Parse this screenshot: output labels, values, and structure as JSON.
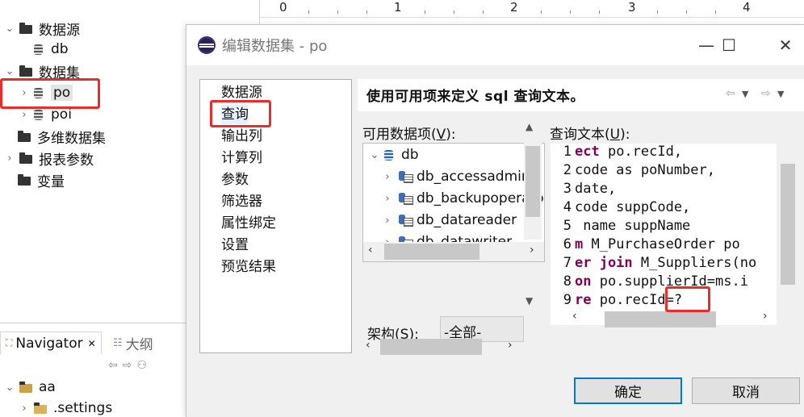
{
  "left_tree": {
    "items": [
      {
        "label": "数据源",
        "twisty": "⌄",
        "icon": "folder-icon"
      },
      {
        "label": "db",
        "twisty": "",
        "icon": "database-icon"
      },
      {
        "label": "数据集",
        "twisty": "⌄",
        "icon": "folder-icon"
      },
      {
        "label": "po",
        "twisty": "›",
        "icon": "dataset-icon"
      },
      {
        "label": "poi",
        "twisty": "›",
        "icon": "dataset-icon"
      },
      {
        "label": "多维数据集",
        "twisty": "",
        "icon": "folder-icon"
      },
      {
        "label": "报表参数",
        "twisty": "›",
        "icon": "folder-icon"
      },
      {
        "label": "变量",
        "twisty": "",
        "icon": "folder-icon"
      }
    ]
  },
  "ruler": {
    "numbers": [
      "0",
      "1",
      "2",
      "3",
      "4"
    ]
  },
  "navigator": {
    "tab_navigator": "Navigator",
    "tab_close": "✕",
    "tab_outline": "大纲",
    "tree": [
      {
        "label": "aa",
        "twisty": "⌄",
        "icon": "project-folder-icon"
      },
      {
        "label": ".settings",
        "twisty": "›",
        "icon": "folder-icon"
      }
    ]
  },
  "dialog": {
    "title": "编辑数据集 - po",
    "minimize": "—",
    "maximize": "☐",
    "close": "✕",
    "pages": [
      "数据源",
      "查询",
      "输出列",
      "计算列",
      "参数",
      "筛选器",
      "属性绑定",
      "设置",
      "预览结果"
    ],
    "header_text": "使用可用项来定义 sql 查询文本。",
    "available_label": "可用数据项(",
    "available_mnemonic": "V",
    "available_label_end": "):",
    "query_label": "查询文本(",
    "query_mnemonic": "U",
    "query_label_end": "):",
    "data_tree": {
      "root": "db",
      "children": [
        "db_accessadmin",
        "db_backupoperator",
        "db_datareader",
        "db_datawriter"
      ]
    },
    "schema_label": "架构(",
    "schema_mnemonic": "S",
    "schema_label_end": "):",
    "schema_value": "-全部-",
    "query_lines": [
      {
        "n": "1",
        "kw": "ect",
        "rest": " po.recId,"
      },
      {
        "n": "2",
        "kw": "",
        "rest": "code as poNumber,"
      },
      {
        "n": "3",
        "kw": "",
        "rest": "date,"
      },
      {
        "n": "4",
        "kw": "",
        "rest": "code suppCode,"
      },
      {
        "n": "5",
        "kw": "",
        "rest": " name suppName"
      },
      {
        "n": "6",
        "kw": "m",
        "rest": " M_PurchaseOrder po"
      },
      {
        "n": "7",
        "kw": "er join",
        "rest": " M_Suppliers(no"
      },
      {
        "n": "8",
        "kw": "on",
        "rest": " po.supplierId=ms.i"
      },
      {
        "n": "9",
        "kw": "re",
        "rest": " po.recId=?"
      }
    ],
    "ok_button": "确定",
    "cancel_button": "取消"
  },
  "colors": {
    "highlight": "#ec2b2b",
    "keyword": "#7f0055",
    "default_button_border": "#0078d7"
  }
}
